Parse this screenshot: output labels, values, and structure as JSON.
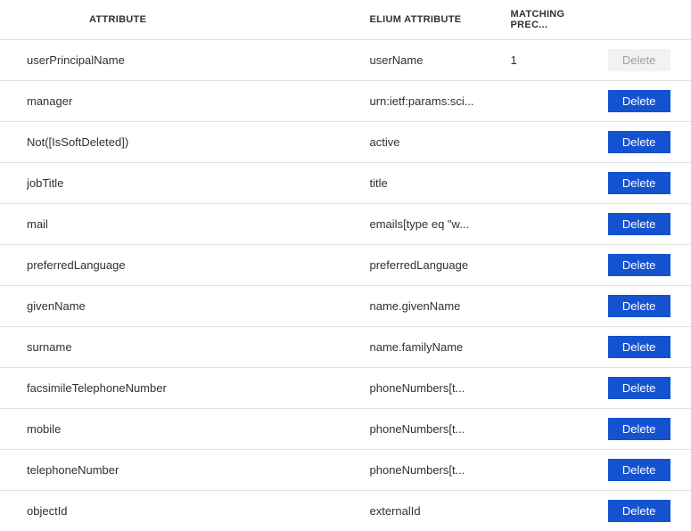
{
  "columns": {
    "attribute": "Attribute",
    "elium": "Elium Attribute",
    "precedence": "Matching prec..."
  },
  "buttons": {
    "delete": "Delete"
  },
  "rows": [
    {
      "attribute": "userPrincipalName",
      "elium": "userName",
      "precedence": "1",
      "disabled": true
    },
    {
      "attribute": "manager",
      "elium": "urn:ietf:params:sci...",
      "precedence": "",
      "disabled": false
    },
    {
      "attribute": "Not([IsSoftDeleted])",
      "elium": "active",
      "precedence": "",
      "disabled": false
    },
    {
      "attribute": "jobTitle",
      "elium": "title",
      "precedence": "",
      "disabled": false
    },
    {
      "attribute": "mail",
      "elium": "emails[type eq \"w...",
      "precedence": "",
      "disabled": false
    },
    {
      "attribute": "preferredLanguage",
      "elium": "preferredLanguage",
      "precedence": "",
      "disabled": false
    },
    {
      "attribute": "givenName",
      "elium": "name.givenName",
      "precedence": "",
      "disabled": false
    },
    {
      "attribute": "surname",
      "elium": "name.familyName",
      "precedence": "",
      "disabled": false
    },
    {
      "attribute": "facsimileTelephoneNumber",
      "elium": "phoneNumbers[t...",
      "precedence": "",
      "disabled": false
    },
    {
      "attribute": "mobile",
      "elium": "phoneNumbers[t...",
      "precedence": "",
      "disabled": false
    },
    {
      "attribute": "telephoneNumber",
      "elium": "phoneNumbers[t...",
      "precedence": "",
      "disabled": false
    },
    {
      "attribute": "objectId",
      "elium": "externalId",
      "precedence": "",
      "disabled": false
    }
  ]
}
